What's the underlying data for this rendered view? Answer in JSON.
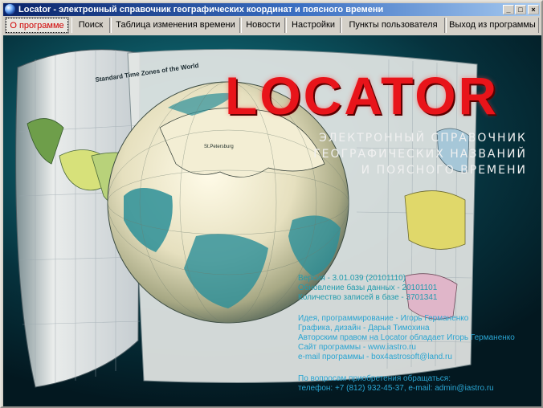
{
  "window": {
    "title": "Locator - электронный справочник географических координат и поясного времени",
    "controls": {
      "minimize": "_",
      "maximize": "□",
      "close": "×"
    }
  },
  "menu": {
    "tabs": [
      {
        "label": "О программе",
        "active": true
      },
      {
        "label": "Поиск"
      },
      {
        "label": "Таблица изменения времени"
      },
      {
        "label": "Новости"
      },
      {
        "label": "Настройки"
      },
      {
        "label": "Пункты пользователя"
      },
      {
        "label": "Выход из программы"
      }
    ]
  },
  "splash": {
    "logo": "LOCATOR",
    "subtitle": [
      "ЭЛЕКТРОННЫЙ СПРАВОЧНИК",
      "ГЕОГРАФИЧЕСКИХ НАЗВАНИЙ",
      "И ПОЯСНОГО ВРЕМЕНИ"
    ],
    "map_heading": "Standard Time Zones of the World",
    "globe_label": "St.Petersburg",
    "version_lines": [
      "Версия - 3.01.039 (20101110)",
      "Обновление базы данных - 20101101",
      "Количество записей в базе - 3701341"
    ],
    "credits_lines": [
      "Идея, программирование - Игорь Германенко",
      "Графика, дизайн - Дарья Тимохина",
      "Авторским правом на Locator обладает Игорь Германенко",
      "Сайт программы - www.iastro.ru",
      "e-mail программы - box4astrosoft@land.ru"
    ],
    "contact_lines": [
      "По вопросам приобретения обращаться:",
      "телефон: +7 (812) 932-45-37, e-mail: admin@iastro.ru"
    ]
  },
  "colors": {
    "logo": "#e8141a",
    "accent_text": "#2aa5d2",
    "active_tab": "#d00000",
    "titlebar": "#0a246a"
  }
}
